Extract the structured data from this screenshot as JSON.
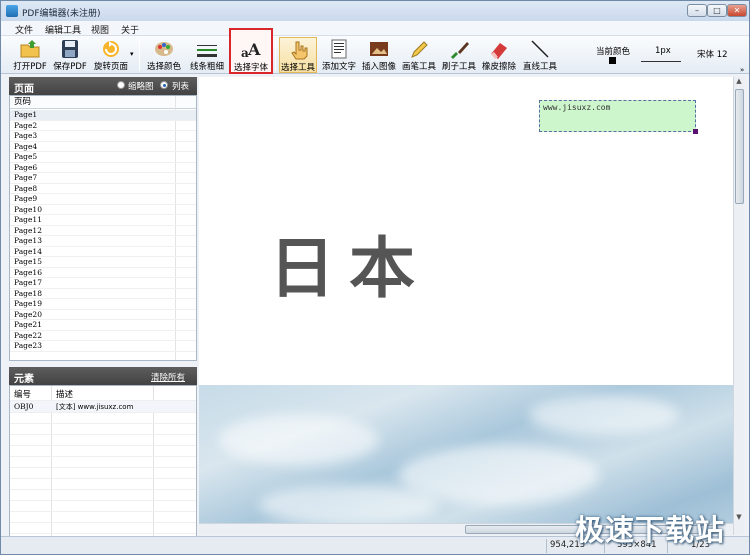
{
  "window": {
    "title": "PDF编辑器(未注册)",
    "minimize": "–",
    "maximize": "□",
    "close": "✕"
  },
  "menu": [
    "文件",
    "编辑工具",
    "视图",
    "关于"
  ],
  "toolbar": {
    "open": "打开PDF",
    "save": "保存PDF",
    "rotate": "旋转页面",
    "color": "选择颜色",
    "line_width": "线条粗细",
    "font": "选择字体",
    "select_tool": "选择工具",
    "add_text": "添加文字",
    "insert_image": "插入图像",
    "pen_tool": "画笔工具",
    "brush_tool": "刷子工具",
    "eraser": "橡皮擦除",
    "line_tool": "直线工具",
    "current_color_label": "当前颜色",
    "line_size": "1px",
    "font_info": "宋体 12"
  },
  "pages_panel": {
    "title": "页面",
    "view_thumbs": "缩略图",
    "view_list": "列表",
    "column": "页码",
    "pages": [
      "Page1",
      "Page2",
      "Page3",
      "Page4",
      "Page5",
      "Page6",
      "Page7",
      "Page8",
      "Page9",
      "Page10",
      "Page11",
      "Page12",
      "Page13",
      "Page14",
      "Page15",
      "Page16",
      "Page17",
      "Page18",
      "Page19",
      "Page20",
      "Page21",
      "Page22",
      "Page23"
    ]
  },
  "elements_panel": {
    "title": "元素",
    "clear_all": "清除所有",
    "col_id": "编号",
    "col_desc": "描述",
    "rows": [
      {
        "id": "OBJ0",
        "desc": "[文本] www.jisuxz.com"
      }
    ]
  },
  "canvas": {
    "watermark_text": "www.jisuxz.com",
    "page_text": "日本"
  },
  "status": {
    "coords": "954,213",
    "page_size": "595×841",
    "page_index": "1/23"
  },
  "brand_overlay": "极速下载站",
  "colors": {
    "accent_select": "#d9262a",
    "panel_header": "#4d4d4d",
    "watermark_bg": "#cdf6cd"
  }
}
